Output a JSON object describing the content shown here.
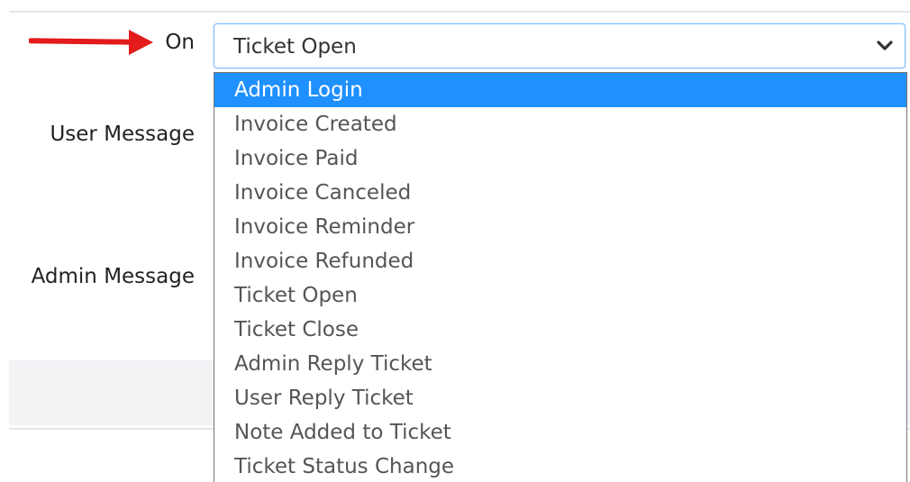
{
  "form": {
    "on_label": "On",
    "user_message_label": "User Message",
    "admin_message_label": "Admin Message"
  },
  "trigger_select": {
    "value": "Ticket Open",
    "highlighted_option": "Admin Login",
    "options": [
      "Admin Login",
      "Invoice Created",
      "Invoice Paid",
      "Invoice Canceled",
      "Invoice Reminder",
      "Invoice Refunded",
      "Ticket Open",
      "Ticket Close",
      "Admin Reply Ticket",
      "User Reply Ticket",
      "Note Added to Ticket",
      "Ticket Status Change"
    ]
  },
  "annotation": {
    "arrow_color": "#e31b1b",
    "arrow_icon": "right-arrow-icon"
  },
  "colors": {
    "select_border": "#80bdff",
    "highlight": "#1e90ff"
  }
}
